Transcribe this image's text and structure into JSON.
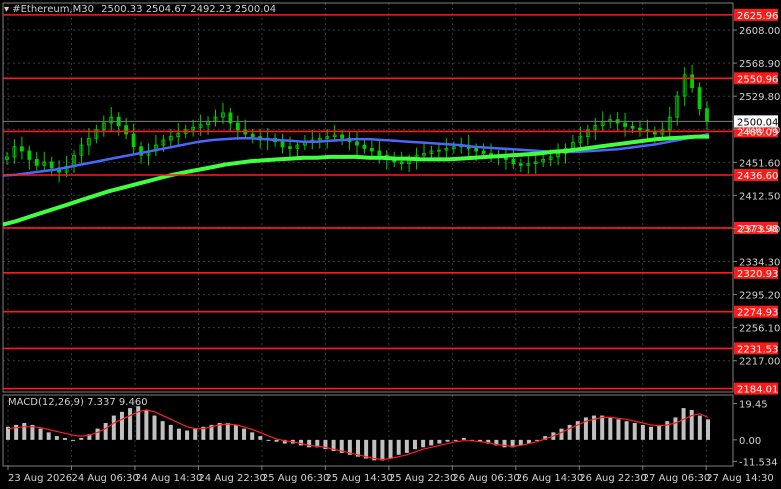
{
  "header": {
    "symbol_label": "#Ethereum,M30",
    "ohlc_label": "2500.33 2504.67 2492.23 2500.04"
  },
  "macd": {
    "label": "MACD(12,26,9) 7.337 9.460",
    "ticks": [
      {
        "value": 19.45,
        "label": "19.45"
      },
      {
        "value": 0.0,
        "label": "0.00"
      },
      {
        "value": -11.534,
        "label": "-11.534"
      }
    ],
    "ylim": [
      -14,
      24
    ]
  },
  "colors": {
    "background": "#000000",
    "grid": "#3a3a3a",
    "candles": "#00d000",
    "support_resistance": "#ff1a1a",
    "ma_fast": "#4a66ff",
    "ma_mid": "#2e7d9a",
    "ma_slow": "#40ff40",
    "macd_hist": "#c0c0c0",
    "macd_signal": "#ff2020",
    "current_price": "#ffffff"
  },
  "chart_data": {
    "type": "line",
    "instrument": "#Ethereum,M30",
    "current_price": {
      "value": 2500.04,
      "label": "2500.04"
    },
    "ylim": [
      2180,
      2640
    ],
    "price_ticks": [
      {
        "value": 2608.0,
        "label": "2608.00"
      },
      {
        "value": 2568.9,
        "label": "2568.90"
      },
      {
        "value": 2529.8,
        "label": "2529.80"
      },
      {
        "value": 2490.7,
        "label": "2490.70"
      },
      {
        "value": 2451.6,
        "label": "2451.60"
      },
      {
        "value": 2412.5,
        "label": "2412.50"
      },
      {
        "value": 2373.4,
        "label": "2373.40"
      },
      {
        "value": 2334.3,
        "label": "2334.30"
      },
      {
        "value": 2295.2,
        "label": "2295.20"
      },
      {
        "value": 2256.1,
        "label": "2256.10"
      },
      {
        "value": 2217.0,
        "label": "2217.00"
      }
    ],
    "levels": [
      {
        "value": 2625.96,
        "label": "2625.96"
      },
      {
        "value": 2550.96,
        "label": "2550.96"
      },
      {
        "value": 2488.09,
        "label": "2488.09"
      },
      {
        "value": 2436.6,
        "label": "2436.60"
      },
      {
        "value": 2373.98,
        "label": "2373.98"
      },
      {
        "value": 2320.93,
        "label": "2320.93"
      },
      {
        "value": 2274.93,
        "label": "2274.93"
      },
      {
        "value": 2231.53,
        "label": "2231.53"
      },
      {
        "value": 2184.01,
        "label": "2184.01"
      }
    ],
    "x_labels": [
      "23 Aug 2026",
      "24 Aug 06:30",
      "24 Aug 14:30",
      "24 Aug 22:30",
      "25 Aug 06:30",
      "25 Aug 14:30",
      "25 Aug 22:30",
      "26 Aug 06:30",
      "26 Aug 14:30",
      "26 Aug 22:30",
      "27 Aug 06:30",
      "27 Aug 14:30"
    ],
    "price_series": [
      2458,
      2470,
      2465,
      2455,
      2448,
      2452,
      2445,
      2440,
      2447,
      2460,
      2472,
      2480,
      2490,
      2498,
      2505,
      2495,
      2485,
      2470,
      2460,
      2465,
      2472,
      2478,
      2482,
      2486,
      2490,
      2493,
      2496,
      2500,
      2505,
      2510,
      2498,
      2490,
      2485,
      2482,
      2478,
      2480,
      2476,
      2470,
      2468,
      2472,
      2475,
      2478,
      2480,
      2482,
      2484,
      2480,
      2476,
      2472,
      2468,
      2465,
      2460,
      2455,
      2452,
      2450,
      2455,
      2460,
      2462,
      2465,
      2466,
      2468,
      2470,
      2472,
      2468,
      2465,
      2462,
      2460,
      2458,
      2455,
      2450,
      2448,
      2450,
      2452,
      2455,
      2458,
      2462,
      2468,
      2475,
      2482,
      2490,
      2495,
      2500,
      2502,
      2498,
      2494,
      2492,
      2490,
      2488,
      2485,
      2490,
      2505,
      2530,
      2555,
      2540,
      2515,
      2500
    ],
    "series": [
      {
        "name": "",
        "role": "ma_fast",
        "values": [
          2436,
          2437,
          2439,
          2441,
          2443,
          2446,
          2449,
          2452,
          2455,
          2458,
          2461,
          2464,
          2467,
          2470,
          2473,
          2476,
          2478,
          2479,
          2480,
          2480,
          2479,
          2478,
          2477,
          2476,
          2476,
          2477,
          2478,
          2479,
          2479,
          2478,
          2477,
          2476,
          2475,
          2474,
          2473,
          2472,
          2470,
          2469,
          2468,
          2467,
          2466,
          2465,
          2464,
          2464,
          2464,
          2465,
          2466,
          2467,
          2469,
          2471,
          2473,
          2476,
          2479,
          2482,
          2485
        ]
      },
      {
        "name": "",
        "role": "ma_slow",
        "values": [
          2378,
          2382,
          2387,
          2392,
          2397,
          2402,
          2407,
          2412,
          2417,
          2421,
          2425,
          2429,
          2433,
          2437,
          2440,
          2443,
          2446,
          2449,
          2451,
          2453,
          2454,
          2455,
          2456,
          2457,
          2457,
          2458,
          2458,
          2458,
          2457,
          2457,
          2456,
          2456,
          2455,
          2455,
          2455,
          2456,
          2457,
          2458,
          2459,
          2460,
          2461,
          2462,
          2464,
          2465,
          2467,
          2469,
          2471,
          2473,
          2475,
          2477,
          2479,
          2480,
          2481,
          2482,
          2482
        ]
      },
      {
        "name": "",
        "role": "macd_hist",
        "values": [
          7,
          8,
          9,
          8,
          6,
          4,
          2,
          1,
          0,
          1,
          3,
          6,
          9,
          13,
          15,
          17,
          18,
          16,
          13,
          10,
          8,
          6,
          5,
          6,
          7,
          8,
          9,
          9,
          8,
          6,
          4,
          2,
          0,
          -1,
          -2,
          -2,
          -3,
          -4,
          -4,
          -5,
          -6,
          -7,
          -8,
          -9,
          -10,
          -11,
          -11,
          -10,
          -8,
          -7,
          -5,
          -4,
          -3,
          -2,
          -1,
          0,
          1,
          0,
          -1,
          -2,
          -3,
          -4,
          -4,
          -3,
          -2,
          0,
          2,
          4,
          6,
          8,
          10,
          12,
          13,
          13,
          12,
          11,
          10,
          9,
          8,
          7,
          8,
          10,
          12,
          17,
          16,
          13,
          11
        ]
      },
      {
        "name": "",
        "role": "macd_signal",
        "values": [
          6,
          6.5,
          7,
          7,
          6.5,
          5.5,
          4.5,
          3.5,
          2.5,
          2,
          2.5,
          4,
          6,
          9,
          11,
          13,
          15,
          16,
          15,
          13,
          11,
          9,
          7,
          6,
          6,
          7,
          8,
          8.5,
          8,
          7,
          5.5,
          4,
          2,
          0.5,
          -0.5,
          -1,
          -2,
          -3,
          -3.5,
          -4,
          -5,
          -6,
          -7,
          -8,
          -9,
          -10,
          -10.5,
          -10,
          -9,
          -8,
          -6.5,
          -5,
          -4,
          -3,
          -2,
          -1,
          -0.5,
          -0.5,
          -1,
          -1.5,
          -2.5,
          -3,
          -3.5,
          -3,
          -2,
          -1,
          0.5,
          2,
          4,
          6,
          8,
          10,
          11,
          12,
          12,
          11.5,
          11,
          10,
          9,
          8,
          7.5,
          8,
          9,
          11,
          13,
          14,
          12
        ]
      }
    ]
  }
}
